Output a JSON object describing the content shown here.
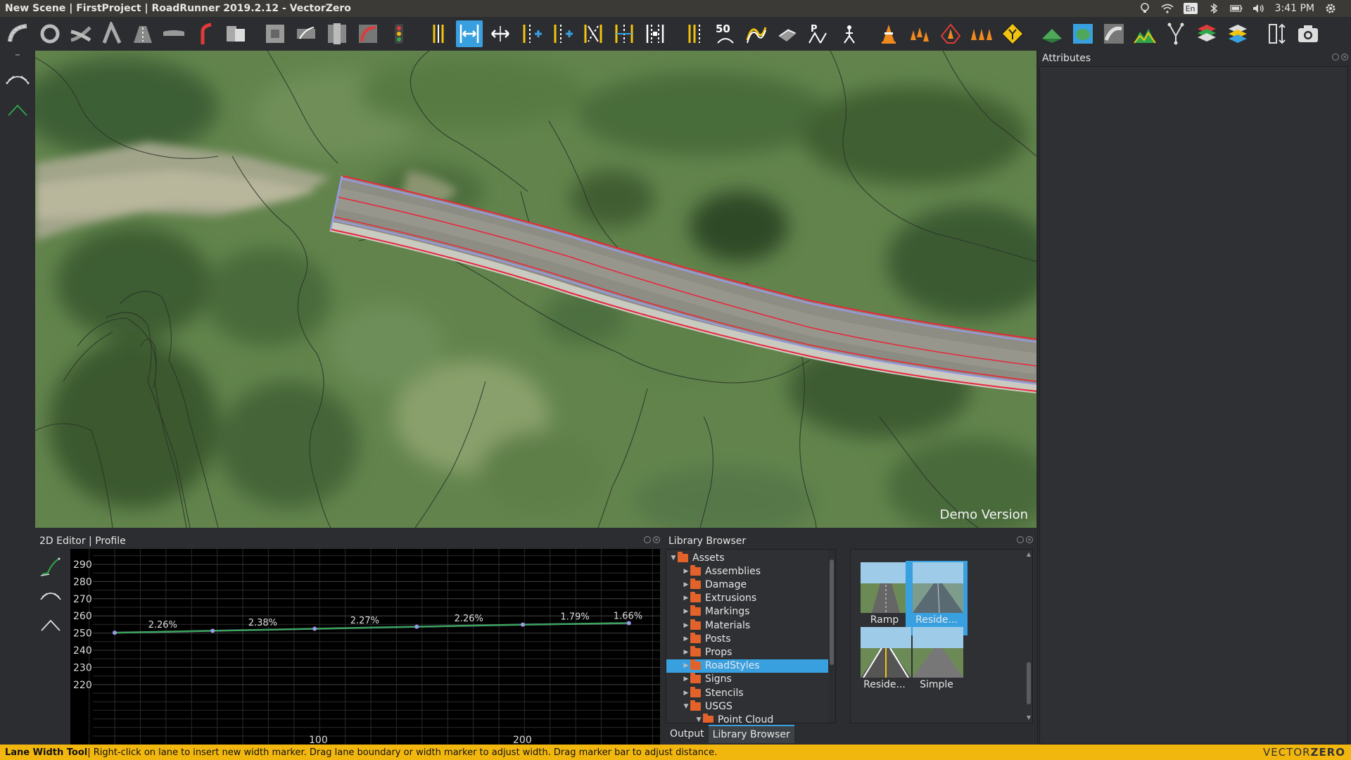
{
  "window": {
    "title": "New Scene | FirstProject | RoadRunner 2019.2.12 - VectorZero"
  },
  "tray": {
    "keyboard": "En",
    "time": "3:41 PM",
    "icons": [
      "lightbulb-icon",
      "wifi-icon",
      "keyboard-icon",
      "bluetooth-icon",
      "battery-icon",
      "volume-icon",
      "gear-icon"
    ]
  },
  "toolbar": {
    "speed_label": "50",
    "tools": [
      "road-plan-tool",
      "roundabout-tool",
      "road-merge-tool",
      "road-fork-tool",
      "road-construction-tool",
      "bridge-tool",
      "corner-tool",
      "lane-carve-tool",
      "junction-tool",
      "junction-connection-tool",
      "junction-edit-tool",
      "maneuver-tool",
      "signal-tool",
      "lane-tool",
      "lane-width-tool",
      "lane-add-tool",
      "lane-form-tool",
      "lane-marking-tool",
      "lane-offset-tool",
      "lane-split-tool",
      "lane-spline-tool",
      "marking-tool",
      "speed-limit-tool",
      "marking-curve-tool",
      "marking-surface-tool",
      "parking-tool",
      "crosswalk-tool",
      "prop-point-tool",
      "prop-curve-tool",
      "prop-polygon-tool",
      "prop-set-tool",
      "sign-tool",
      "surface-tool",
      "terrain-tool",
      "elevation-tool",
      "asset-tool",
      "layer-tool",
      "layer-stack-tool",
      "height-tool",
      "snapshot-tool"
    ]
  },
  "viewport": {
    "watermark": "Demo Version"
  },
  "attributes_panel": {
    "title": "Attributes"
  },
  "editor2d": {
    "title": "2D Editor | Profile",
    "y_ticks": [
      "290",
      "280",
      "270",
      "260",
      "250",
      "240",
      "230",
      "220"
    ],
    "x_ticks": [
      "100",
      "200"
    ],
    "grades": [
      "2.26%",
      "2.38%",
      "2.27%",
      "2.26%",
      "1.79%",
      "1.66%"
    ]
  },
  "chart_data": {
    "type": "line",
    "xlabel": "",
    "ylabel": "",
    "x_ticks": [
      100,
      200
    ],
    "y_ticks": [
      290,
      280,
      270,
      260,
      250,
      240,
      230,
      220
    ],
    "ylim": [
      215,
      300
    ],
    "xlim": [
      -5,
      290
    ],
    "grid": true,
    "series": [
      {
        "x": [
          0,
          48,
          98,
          148,
          200,
          252
        ],
        "y": [
          250.2,
          251.3,
          252.5,
          253.7,
          254.9,
          255.8
        ]
      }
    ],
    "annotations": [
      "2.26%",
      "2.38%",
      "2.27%",
      "2.26%",
      "1.79%",
      "1.66%"
    ]
  },
  "library": {
    "title": "Library Browser",
    "tree": [
      {
        "label": "Assets",
        "level": 0,
        "expanded": true,
        "selected": false
      },
      {
        "label": "Assemblies",
        "level": 1,
        "expanded": false,
        "selected": false
      },
      {
        "label": "Damage",
        "level": 1,
        "expanded": false,
        "selected": false
      },
      {
        "label": "Extrusions",
        "level": 1,
        "expanded": false,
        "selected": false
      },
      {
        "label": "Markings",
        "level": 1,
        "expanded": false,
        "selected": false
      },
      {
        "label": "Materials",
        "level": 1,
        "expanded": false,
        "selected": false
      },
      {
        "label": "Posts",
        "level": 1,
        "expanded": false,
        "selected": false
      },
      {
        "label": "Props",
        "level": 1,
        "expanded": false,
        "selected": false
      },
      {
        "label": "RoadStyles",
        "level": 1,
        "expanded": false,
        "selected": true
      },
      {
        "label": "Signs",
        "level": 1,
        "expanded": false,
        "selected": false
      },
      {
        "label": "Stencils",
        "level": 1,
        "expanded": false,
        "selected": false
      },
      {
        "label": "USGS",
        "level": 1,
        "expanded": true,
        "selected": false
      },
      {
        "label": "Point Cloud",
        "level": 2,
        "expanded": true,
        "selected": false
      }
    ],
    "tabs": [
      "Output",
      "Library Browser"
    ],
    "active_tab": "Library Browser",
    "thumbs": [
      {
        "label": "Ramp",
        "selected": false
      },
      {
        "label": "Reside...",
        "selected": true
      },
      {
        "label": "Reside...",
        "selected": false
      },
      {
        "label": "Simple",
        "selected": false
      }
    ]
  },
  "status": {
    "tool_name": "Lane Width Tool",
    "message": " | Right-click on lane to insert new width marker. Drag lane boundary or width marker to adjust width. Drag marker bar to adjust distance."
  },
  "brand": {
    "light": "VECTOR",
    "bold": "ZERO"
  },
  "colors": {
    "accent": "#39a0e0",
    "status_bar": "#f2b70f",
    "road_edge": "#e8263a",
    "lane_line": "#9a9ae8",
    "profile_line": "#2ea84a"
  }
}
